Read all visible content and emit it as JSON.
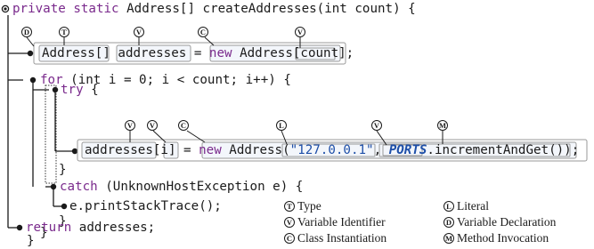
{
  "code": {
    "signature": [
      "private static ",
      "Address[] createAddresses(int count) {"
    ],
    "line_decl": [
      "Address[]",
      " ",
      "addresses",
      " = ",
      "new",
      " Address[",
      "count",
      "];"
    ],
    "for_line": [
      "for",
      " (int i = 0; i < count; i++) {"
    ],
    "try_line": [
      "try",
      " {"
    ],
    "assign_line": [
      "addresses",
      "[",
      "i",
      "] = ",
      "new",
      " Address(",
      "\"127.0.0.1\"",
      ", ",
      "PORTS",
      ".incrementAndGet());"
    ],
    "close_try": "}",
    "catch_line": [
      "catch",
      " (UnknownHostException e) {"
    ],
    "print_line": "e.printStackTrace();",
    "close_catch": "}",
    "close_for": "}",
    "return_line": [
      "return",
      " addresses;"
    ],
    "close_method": "}"
  },
  "badges": [
    "D",
    "T",
    "V",
    "C",
    "V",
    "V",
    "V",
    "C",
    "L",
    "V",
    "M"
  ],
  "legend": [
    {
      "letter": "T",
      "label": "Type"
    },
    {
      "letter": "V",
      "label": "Variable Identifier"
    },
    {
      "letter": "C",
      "label": "Class Instantiation"
    },
    {
      "letter": "L",
      "label": "Literal"
    },
    {
      "letter": "D",
      "label": "Variable Declaration"
    },
    {
      "letter": "M",
      "label": "Method Invocation"
    }
  ],
  "colors": {
    "keyword": "#7a2a8c",
    "string_literal": "#1e4fa8",
    "box_border": "#9a9a9a",
    "tree_line": "#1a1a1a"
  }
}
